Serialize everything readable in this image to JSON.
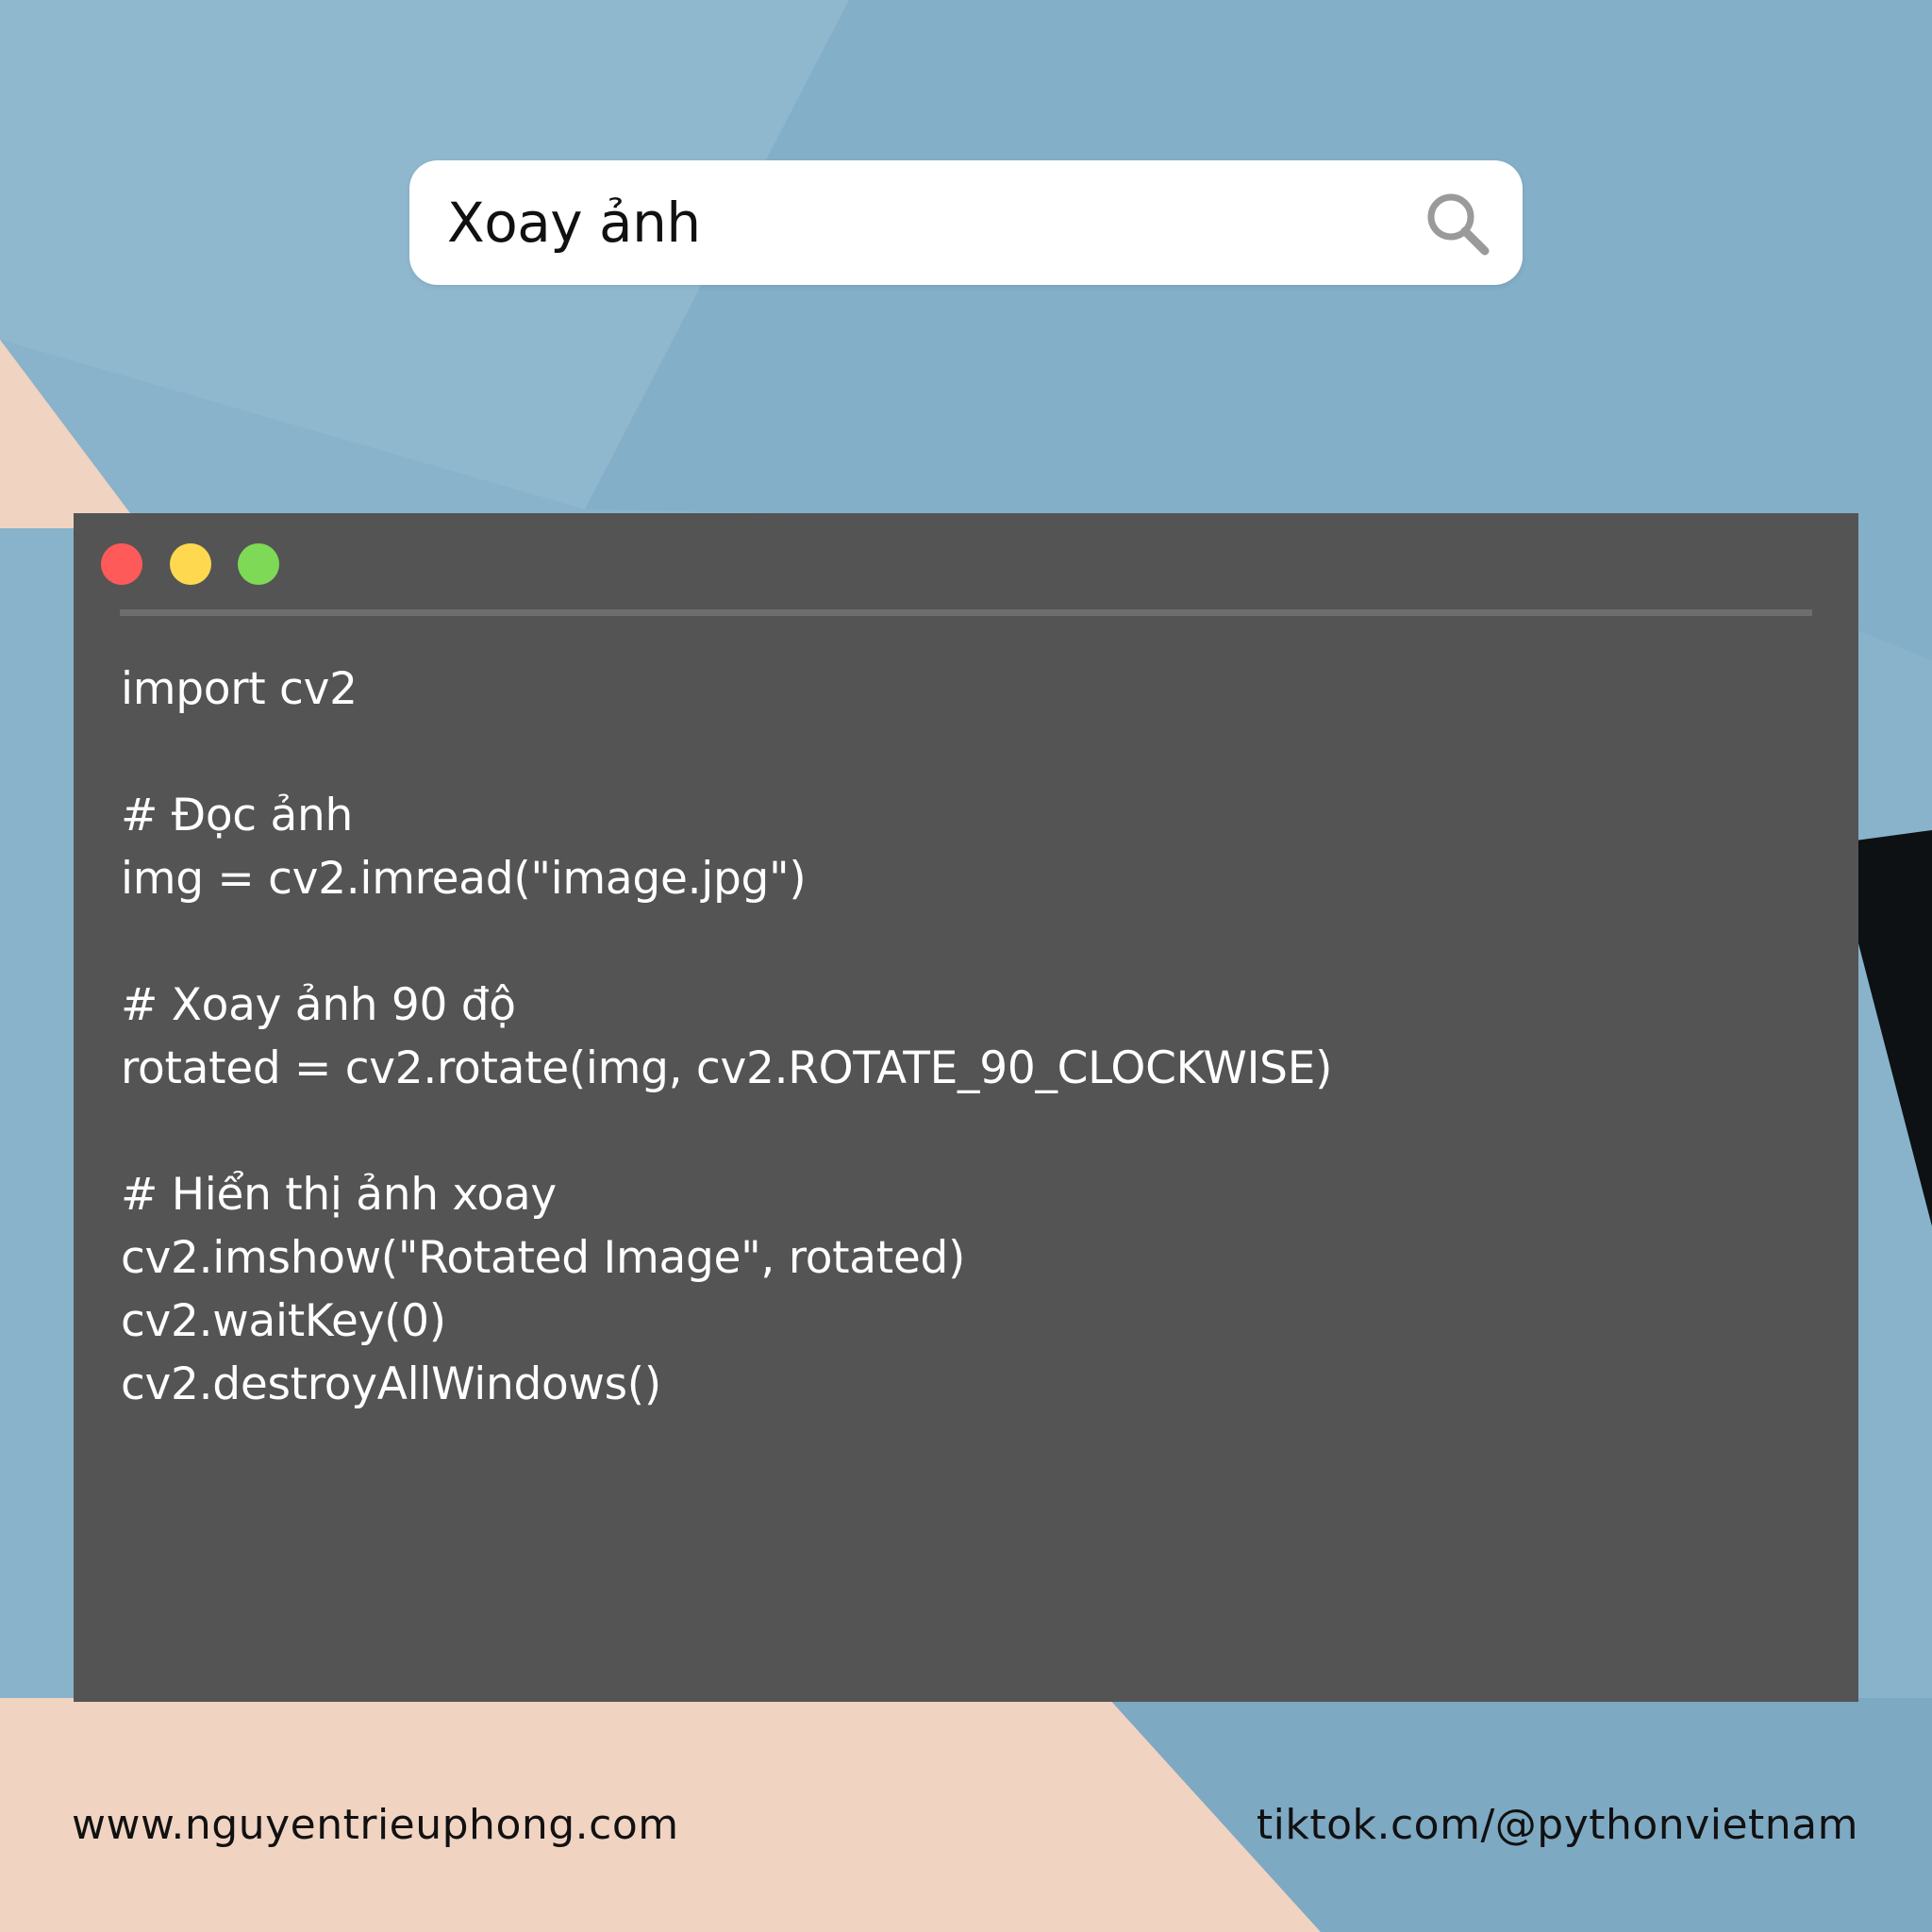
{
  "search": {
    "query": "Xoay ảnh",
    "icon": "search-icon"
  },
  "window": {
    "controls": [
      "close-dot",
      "minimize-dot",
      "maximize-dot"
    ],
    "colors": {
      "red": "#fe5a5a",
      "yellow": "#fed950",
      "green": "#7ed957",
      "background": "#545454"
    }
  },
  "code": {
    "lines": [
      "import cv2",
      "",
      "# Đọc ảnh",
      "img = cv2.imread(\"image.jpg\")",
      "",
      "# Xoay ảnh 90 độ",
      "rotated = cv2.rotate(img, cv2.ROTATE_90_CLOCKWISE)",
      "",
      "# Hiển thị ảnh xoay",
      "cv2.imshow(\"Rotated Image\", rotated)",
      "cv2.waitKey(0)",
      "cv2.destroyAllWindows()"
    ]
  },
  "footer": {
    "website": "www.nguyentrieuphong.com",
    "tiktok": "tiktok.com/@pythonvietnam"
  }
}
